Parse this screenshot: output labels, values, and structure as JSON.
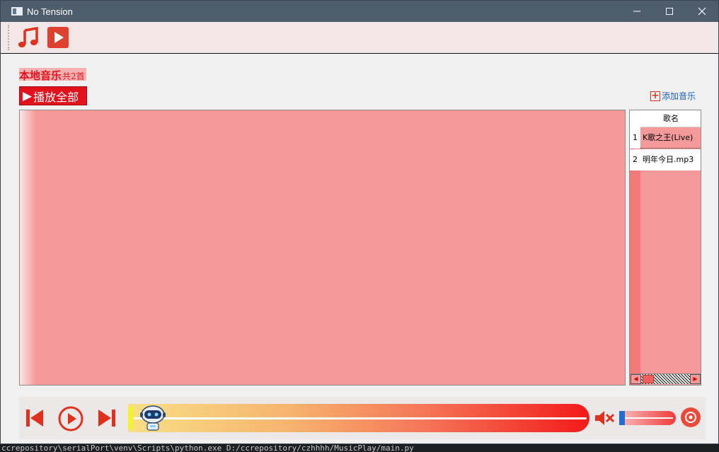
{
  "window": {
    "title": "No Tension",
    "minimize_icon": "minimize-icon",
    "maximize_icon": "maximize-icon",
    "close_icon": "close-icon"
  },
  "toolbar": {
    "music_icon": "music-note-icon",
    "video_icon": "video-play-icon"
  },
  "library": {
    "title": "本地音乐",
    "count": "共2首",
    "play_all_label": "播放全部",
    "add_music_label": "添加音乐"
  },
  "song_table": {
    "header": "歌名",
    "rows": [
      {
        "index": "1",
        "name": "K歌之王(Live)"
      },
      {
        "index": "2",
        "name": "明年今日.mp3"
      }
    ]
  },
  "terminal": {
    "command": "ccrepository\\serialPort\\venv\\Scripts\\python.exe D:/ccrepository/czhhhh/MusicPlay/main.py"
  },
  "colors": {
    "accent": "#e1121c",
    "panel": "#f49a9a",
    "titlebar": "#4e5d6c",
    "volume_handle": "#1f6ed6"
  }
}
